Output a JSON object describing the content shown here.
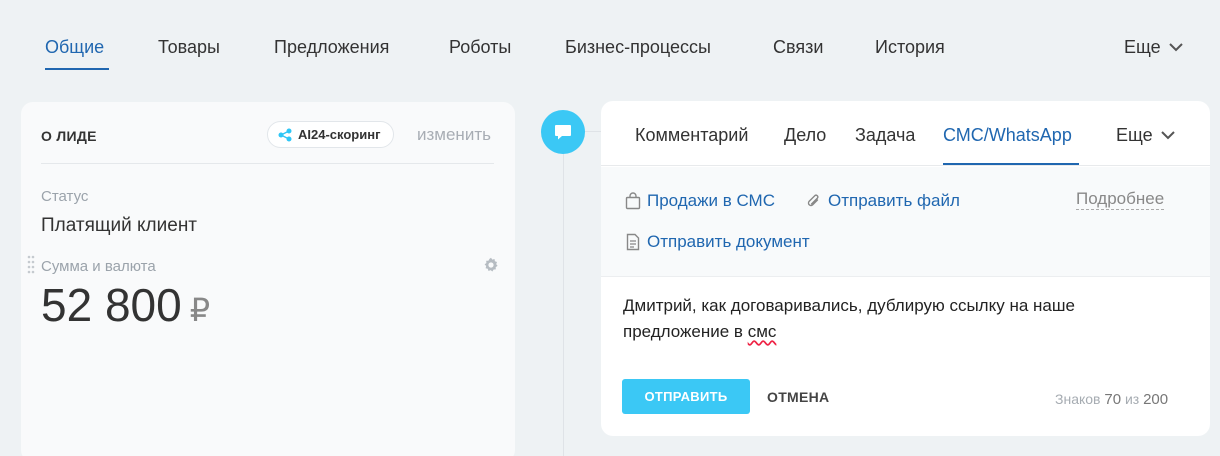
{
  "top_tabs": {
    "items": [
      {
        "label": "Общие",
        "active": true
      },
      {
        "label": "Товары"
      },
      {
        "label": "Предложения"
      },
      {
        "label": "Роботы"
      },
      {
        "label": "Бизнес-процессы"
      },
      {
        "label": "Связи"
      },
      {
        "label": "История"
      }
    ],
    "more_label": "Еще"
  },
  "lead_card": {
    "title": "О ЛИДЕ",
    "ai_badge": "AI24-скоринг",
    "change_label": "изменить",
    "status_label": "Статус",
    "status_value": "Платящий клиент",
    "amount_label": "Сумма и валюта",
    "amount_value": "52 800",
    "currency": "₽"
  },
  "activity": {
    "tabs": [
      "Комментарий",
      "Дело",
      "Задача",
      "СМС/WhatsApp"
    ],
    "active_tab": "СМС/WhatsApp",
    "more_label": "Еще",
    "tools": {
      "sales_sms": "Продажи в СМС",
      "send_file": "Отправить файл",
      "send_document": "Отправить документ",
      "more_details": "Подробнее"
    },
    "message_line1": "Дмитрий, как договаривались, дублирую ссылку на наше",
    "message_line2_text": "предложение в ",
    "message_line2_err": "смс",
    "send_label": "ОТПРАВИТЬ",
    "cancel_label": "ОТМЕНА",
    "counter_prefix": "Знаков",
    "counter_value": "70",
    "counter_sep": "из",
    "counter_max": "200"
  },
  "colors": {
    "accent_blue": "#2067b0",
    "button_cyan": "#3bc8f5",
    "background": "#eef2f4"
  }
}
